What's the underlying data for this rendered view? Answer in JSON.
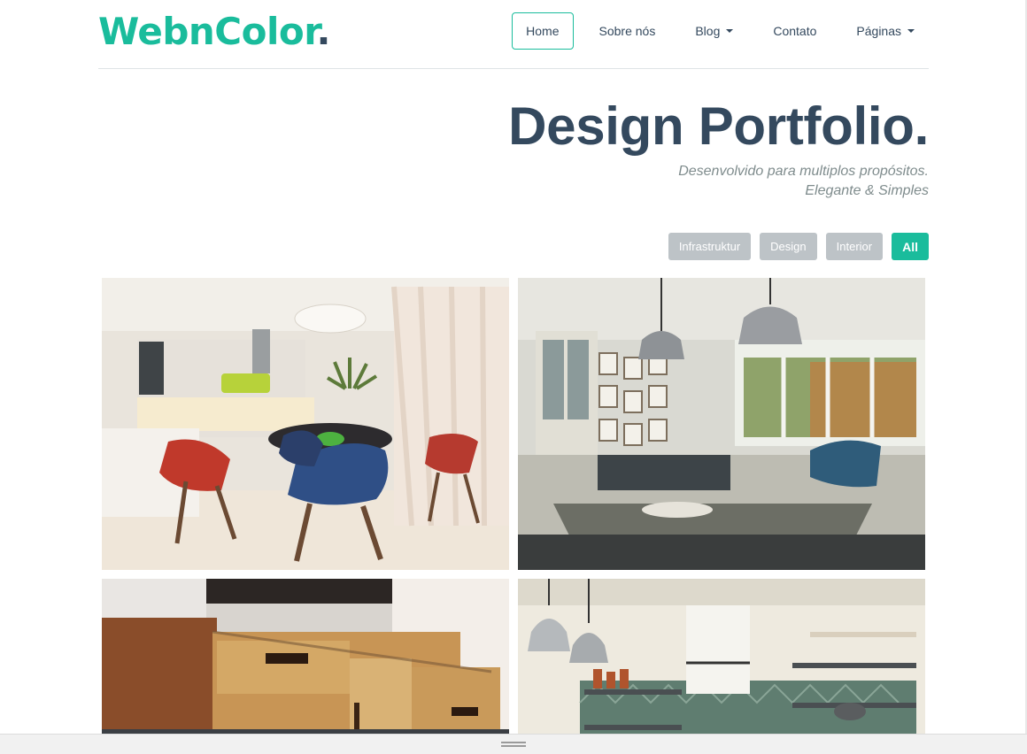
{
  "brand": {
    "name": "WebnColor",
    "dot": ".",
    "accent": "#1abc9c",
    "dark": "#34495e"
  },
  "nav": {
    "home": "Home",
    "about": "Sobre nós",
    "blog": "Blog",
    "contact": "Contato",
    "pages": "Páginas"
  },
  "hero": {
    "title": "Design Portfolio.",
    "subtitle_line1": "Desenvolvido para multiplos propósitos.",
    "subtitle_line2": "Elegante & Simples"
  },
  "filters": [
    "Infrastruktur",
    "Design",
    "Interior",
    "All"
  ],
  "active_filter": "All",
  "gallery": [
    {
      "subject": "modern-kitchen-dining"
    },
    {
      "subject": "living-room-dining"
    },
    {
      "subject": "wooden-tv-cabinet"
    },
    {
      "subject": "kitchen-shelves-pendant-lamps"
    }
  ],
  "icons": {
    "caret": "chevron-down-icon",
    "resize": "drag-handle-icon"
  }
}
